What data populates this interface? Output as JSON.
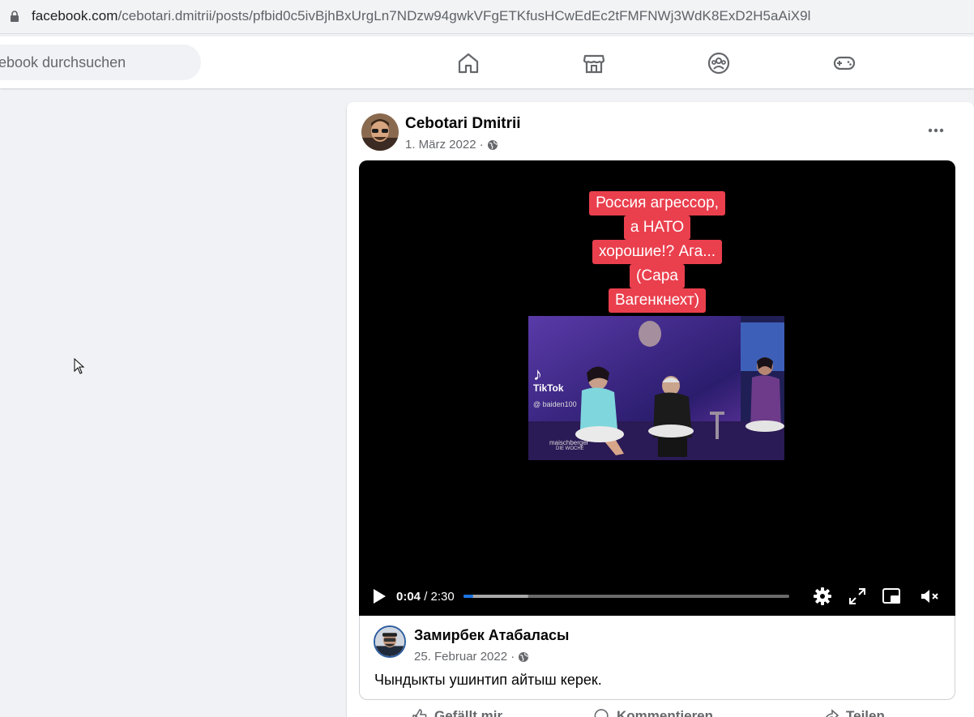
{
  "browser": {
    "url_host": "facebook.com",
    "url_path": "/cebotari.dmitrii/posts/pfbid0c5ivBjhBxUrgLn7NDzw94gwkVFgETKfusHCwEdEc2tFMFNWj3WdK8ExD2H5aAiX9l"
  },
  "header": {
    "search_placeholder": "ebook durchsuchen",
    "nav": [
      "home-icon",
      "marketplace-icon",
      "groups-icon",
      "gaming-icon"
    ]
  },
  "post": {
    "author": "Cebotari Dmitrii",
    "date": "1. März 2022 ·",
    "privacy_icon": "globe-icon"
  },
  "video": {
    "caption_lines": [
      "Россия агрессор,",
      "а НАТО",
      "хорошие!? Ага...",
      "(Сара",
      "Вагенкнехт)"
    ],
    "tiktok_label": "TikTok",
    "tiktok_handle": "@ baiden100",
    "show_label": "maischberger",
    "show_sublabel": "DIE WOCHE",
    "time_current": "0:04",
    "time_total": "/ 2:30",
    "progress_played": 0.03,
    "progress_buffered": 0.2
  },
  "shared": {
    "author": "Замирбек Атабаласы",
    "date": "25. Februar 2022 ·",
    "text": "Чындыкты ушинтип айтыш керек."
  },
  "actions": {
    "like": "Gefällt mir",
    "comment": "Kommentieren",
    "share": "Teilen"
  },
  "colors": {
    "accent": "#1b74e4",
    "caption_bg": "#ea3f4d"
  }
}
